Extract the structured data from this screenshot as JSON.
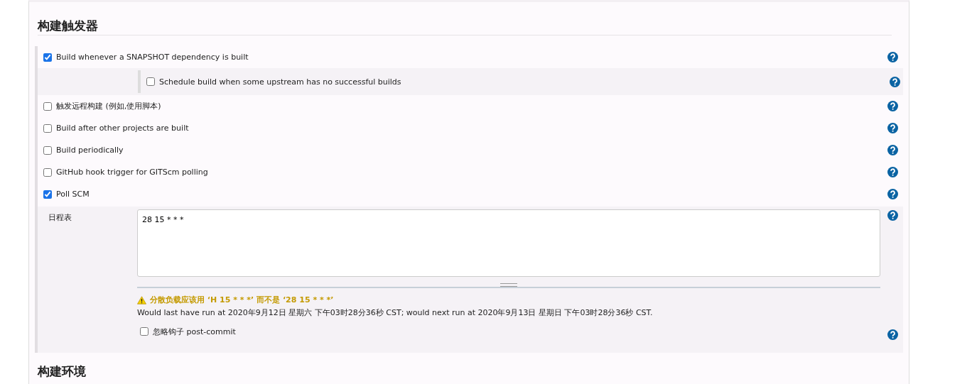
{
  "section_title": "构建触发器",
  "triggers": [
    {
      "label": "Build whenever a SNAPSHOT dependency is built",
      "checked": true,
      "sub_options": [
        {
          "label": "Schedule build when some upstream has no successful builds",
          "checked": false
        }
      ]
    },
    {
      "label": "触发远程构建 (例如,使用脚本)",
      "checked": false
    },
    {
      "label": "Build after other projects are built",
      "checked": false
    },
    {
      "label": "Build periodically",
      "checked": false
    },
    {
      "label": "GitHub hook trigger for GITScm polling",
      "checked": false
    },
    {
      "label": "Poll SCM",
      "checked": true,
      "schedule": {
        "label": "日程表",
        "value": "28 15 * * *",
        "warning": "分散负载应该用 ‘H 15 * * *’ 而不是 ‘28 15 * * *’",
        "info": "Would last have run at 2020年9月12日 星期六 下午03时28分36秒 CST; would next run at 2020年9月13日 星期日 下午03时28分36秒 CST.",
        "options": [
          {
            "label": "忽略钩子 post-commit",
            "checked": false
          }
        ]
      }
    }
  ],
  "next_section_title": "构建环境"
}
